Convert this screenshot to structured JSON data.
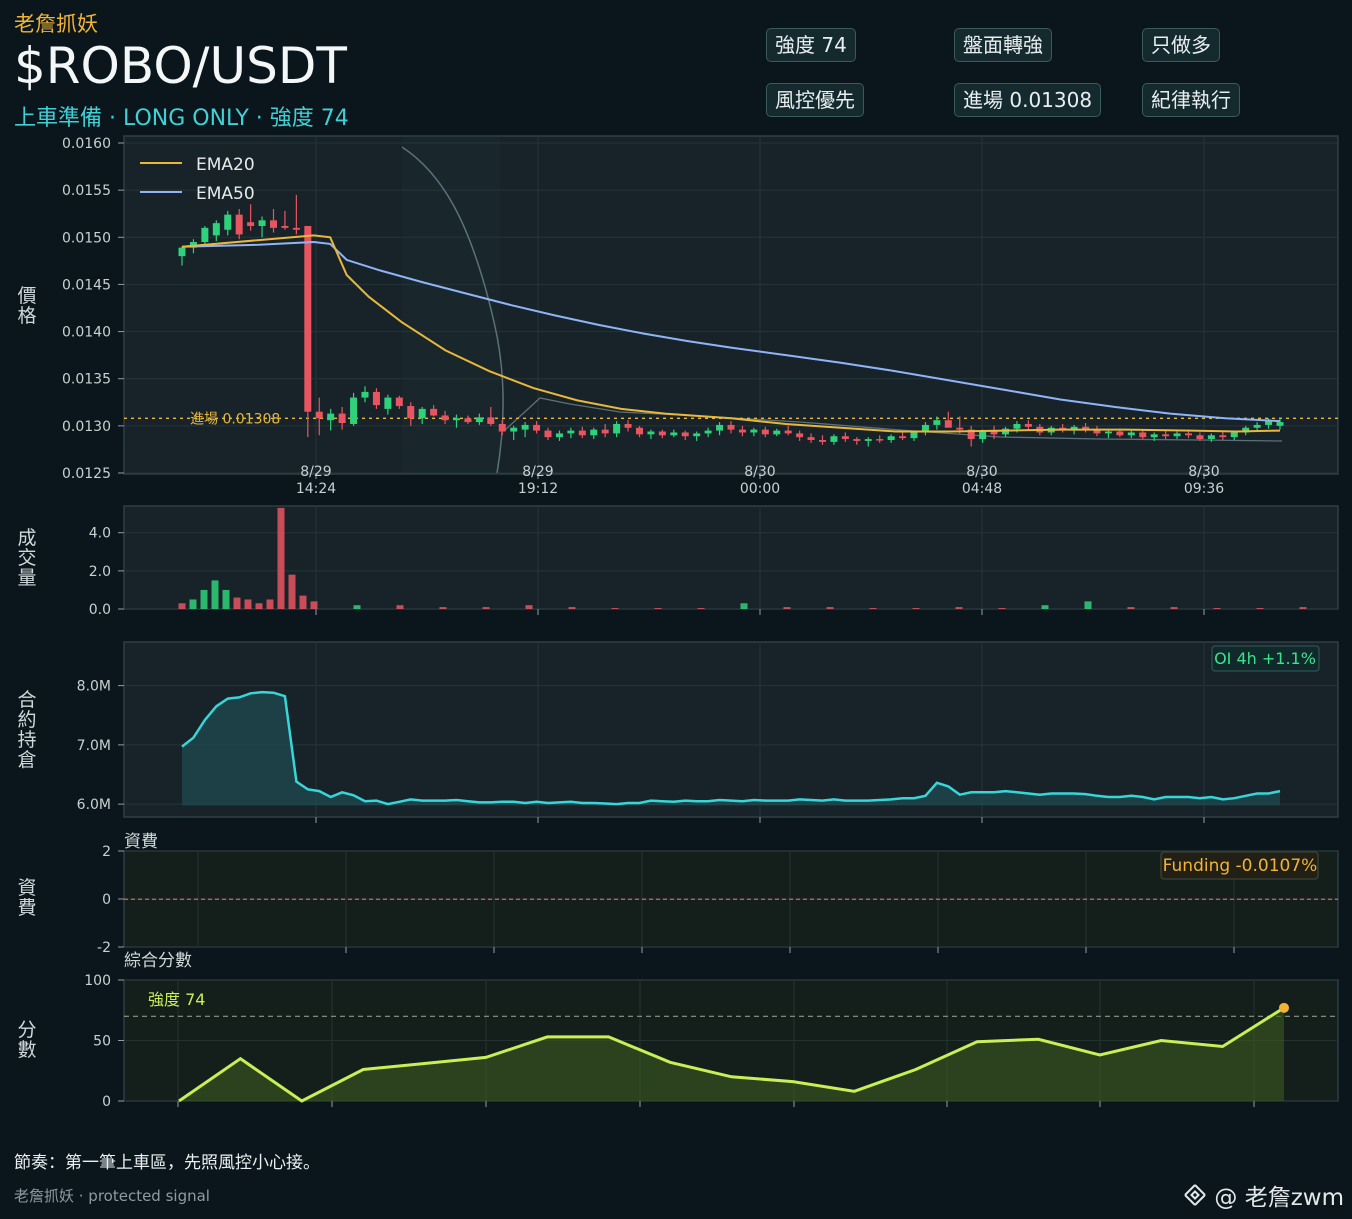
{
  "header": {
    "brand": "老詹抓妖",
    "symbol": "$ROBO/USDT",
    "subtitle": "上車準備 · LONG ONLY · 強度 74",
    "badges": [
      "強度 74",
      "盤面轉強",
      "只做多",
      "風控優先",
      "進場 0.01308",
      "紀律執行"
    ]
  },
  "panel_labels": {
    "price": "價格",
    "volume": "成交量",
    "oi": "合約持倉",
    "funding": "資費",
    "score": "分數"
  },
  "footer": {
    "note": "節奏：第一筆上車區，先照風控小心接。",
    "signature": "老詹抓妖 · protected signal",
    "watermark": "@ 老詹zwm"
  },
  "colors": {
    "up": "#2fd17a",
    "down": "#e85560",
    "ema20": "#e9b73a",
    "ema50": "#8fb4f7",
    "oi": "#37d6d8",
    "score": "#c8ef55",
    "accent": "#f1b434"
  },
  "icons": {
    "watermark": "binance-logo-icon"
  },
  "chart_data": [
    {
      "type": "candlestick",
      "ylim": [
        0.0125,
        0.016
      ],
      "yticks": [
        "0.0125",
        "0.0130",
        "0.0135",
        "0.0140",
        "0.0145",
        "0.0150",
        "0.0155",
        "0.0160"
      ],
      "xticks": [
        {
          "date": "8/29",
          "time": "14:24"
        },
        {
          "date": "8/29",
          "time": "19:12"
        },
        {
          "date": "8/30",
          "time": "00:00"
        },
        {
          "date": "8/30",
          "time": "04:48"
        },
        {
          "date": "8/30",
          "time": "09:36"
        }
      ],
      "legend": [
        "EMA20",
        "EMA50"
      ],
      "legend_position": "top-left",
      "entry_line": {
        "value": 0.01308,
        "label": "進場 0.01308"
      },
      "candles": [
        [
          0.0148,
          0.0149,
          0.0147,
          0.01489
        ],
        [
          0.01489,
          0.01498,
          0.01483,
          0.01495
        ],
        [
          0.01495,
          0.01512,
          0.01492,
          0.0151
        ],
        [
          0.01502,
          0.01518,
          0.01496,
          0.01515
        ],
        [
          0.01508,
          0.01528,
          0.01502,
          0.01524
        ],
        [
          0.01524,
          0.0153,
          0.01498,
          0.01503
        ],
        [
          0.01516,
          0.01535,
          0.01507,
          0.01512
        ],
        [
          0.01512,
          0.01522,
          0.015,
          0.01518
        ],
        [
          0.01518,
          0.0153,
          0.01505,
          0.0151
        ],
        [
          0.01512,
          0.01528,
          0.01508,
          0.0151
        ],
        [
          0.0151,
          0.01545,
          0.01503,
          0.01508
        ],
        [
          0.01512,
          0.01512,
          0.01288,
          0.01315
        ],
        [
          0.01315,
          0.0133,
          0.0129,
          0.01308
        ],
        [
          0.01306,
          0.01318,
          0.01295,
          0.01313
        ],
        [
          0.01313,
          0.0132,
          0.01296,
          0.01303
        ],
        [
          0.01302,
          0.01335,
          0.013,
          0.0133
        ],
        [
          0.0133,
          0.01342,
          0.01325,
          0.01336
        ],
        [
          0.01336,
          0.0134,
          0.01318,
          0.01322
        ],
        [
          0.01318,
          0.01333,
          0.01312,
          0.0133
        ],
        [
          0.0133,
          0.01332,
          0.01318,
          0.01321
        ],
        [
          0.01321,
          0.01325,
          0.013,
          0.01308
        ],
        [
          0.01308,
          0.0132,
          0.01302,
          0.01318
        ],
        [
          0.01318,
          0.01322,
          0.0131,
          0.01311
        ],
        [
          0.01311,
          0.01316,
          0.01302,
          0.01306
        ],
        [
          0.01306,
          0.01312,
          0.01298,
          0.01308
        ],
        [
          0.01308,
          0.01311,
          0.01302,
          0.01304
        ],
        [
          0.01304,
          0.01313,
          0.01301,
          0.01309
        ],
        [
          0.01309,
          0.0132,
          0.013,
          0.01302
        ],
        [
          0.01302,
          0.01306,
          0.0129,
          0.01294
        ],
        [
          0.01294,
          0.013,
          0.01285,
          0.01298
        ],
        [
          0.01296,
          0.01304,
          0.01288,
          0.01301
        ],
        [
          0.01301,
          0.01305,
          0.01292,
          0.01295
        ],
        [
          0.01295,
          0.01298,
          0.01285,
          0.01288
        ],
        [
          0.01288,
          0.01295,
          0.01284,
          0.01292
        ],
        [
          0.01292,
          0.01298,
          0.01287,
          0.01295
        ],
        [
          0.01295,
          0.01299,
          0.01287,
          0.0129
        ],
        [
          0.0129,
          0.01298,
          0.01286,
          0.01296
        ],
        [
          0.01296,
          0.01302,
          0.01288,
          0.01292
        ],
        [
          0.01292,
          0.01305,
          0.01288,
          0.01302
        ],
        [
          0.01302,
          0.01306,
          0.01294,
          0.01298
        ],
        [
          0.01298,
          0.013,
          0.01288,
          0.01291
        ],
        [
          0.01291,
          0.01296,
          0.01286,
          0.01294
        ],
        [
          0.01294,
          0.01296,
          0.01287,
          0.0129
        ],
        [
          0.0129,
          0.01296,
          0.01288,
          0.01293
        ],
        [
          0.01293,
          0.01295,
          0.01285,
          0.01289
        ],
        [
          0.01289,
          0.01294,
          0.01284,
          0.01292
        ],
        [
          0.01292,
          0.01298,
          0.01288,
          0.01295
        ],
        [
          0.01295,
          0.01304,
          0.0129,
          0.01301
        ],
        [
          0.01301,
          0.01305,
          0.01292,
          0.01296
        ],
        [
          0.01296,
          0.013,
          0.01289,
          0.01293
        ],
        [
          0.01293,
          0.01298,
          0.01289,
          0.01296
        ],
        [
          0.01296,
          0.01299,
          0.01288,
          0.01291
        ],
        [
          0.01291,
          0.01297,
          0.01289,
          0.01295
        ],
        [
          0.01295,
          0.013,
          0.0129,
          0.01292
        ],
        [
          0.01292,
          0.01295,
          0.01284,
          0.01288
        ],
        [
          0.01288,
          0.01292,
          0.01282,
          0.01285
        ],
        [
          0.01285,
          0.0129,
          0.0128,
          0.01283
        ],
        [
          0.01283,
          0.01291,
          0.0128,
          0.01289
        ],
        [
          0.01289,
          0.01293,
          0.01283,
          0.01286
        ],
        [
          0.01286,
          0.01288,
          0.0128,
          0.01284
        ],
        [
          0.01284,
          0.01288,
          0.01278,
          0.01286
        ],
        [
          0.01286,
          0.0129,
          0.01282,
          0.01285
        ],
        [
          0.01285,
          0.01291,
          0.01282,
          0.01289
        ],
        [
          0.01289,
          0.01294,
          0.01285,
          0.01287
        ],
        [
          0.01287,
          0.01295,
          0.01284,
          0.01293
        ],
        [
          0.01293,
          0.01304,
          0.0129,
          0.01301
        ],
        [
          0.01301,
          0.0131,
          0.01296,
          0.01306
        ],
        [
          0.01306,
          0.01315,
          0.013,
          0.01298
        ],
        [
          0.01298,
          0.0131,
          0.01292,
          0.01296
        ],
        [
          0.01296,
          0.013,
          0.01278,
          0.01286
        ],
        [
          0.01286,
          0.01296,
          0.01282,
          0.01294
        ],
        [
          0.01294,
          0.013,
          0.01286,
          0.01291
        ],
        [
          0.01291,
          0.01299,
          0.01288,
          0.01297
        ],
        [
          0.01297,
          0.01305,
          0.01293,
          0.01302
        ],
        [
          0.01302,
          0.01306,
          0.01296,
          0.01299
        ],
        [
          0.01299,
          0.01302,
          0.0129,
          0.01293
        ],
        [
          0.01293,
          0.013,
          0.0129,
          0.01298
        ],
        [
          0.01298,
          0.01302,
          0.01293,
          0.01296
        ],
        [
          0.01296,
          0.01301,
          0.01291,
          0.01299
        ],
        [
          0.01299,
          0.01303,
          0.01293,
          0.01296
        ],
        [
          0.01296,
          0.013,
          0.01289,
          0.01292
        ],
        [
          0.01292,
          0.01296,
          0.01287,
          0.01294
        ],
        [
          0.01294,
          0.01297,
          0.01288,
          0.0129
        ],
        [
          0.0129,
          0.01295,
          0.01287,
          0.01293
        ],
        [
          0.01293,
          0.01296,
          0.01286,
          0.01288
        ],
        [
          0.01288,
          0.01293,
          0.01284,
          0.01291
        ],
        [
          0.01291,
          0.01296,
          0.01286,
          0.01289
        ],
        [
          0.01289,
          0.01294,
          0.01286,
          0.01292
        ],
        [
          0.01292,
          0.01296,
          0.01287,
          0.0129
        ],
        [
          0.0129,
          0.01293,
          0.01284,
          0.01286
        ],
        [
          0.01286,
          0.01292,
          0.01283,
          0.0129
        ],
        [
          0.0129,
          0.01294,
          0.01285,
          0.01288
        ],
        [
          0.01288,
          0.01295,
          0.01285,
          0.01293
        ],
        [
          0.01293,
          0.013,
          0.0129,
          0.01298
        ],
        [
          0.01298,
          0.01304,
          0.01295,
          0.01301
        ],
        [
          0.01301,
          0.01308,
          0.01297,
          0.01306
        ],
        [
          0.013,
          0.01309,
          0.01296,
          0.01304
        ]
      ],
      "ema20": [
        [
          0,
          0.0149
        ],
        [
          0.07,
          0.01497
        ],
        [
          0.12,
          0.01502
        ],
        [
          0.135,
          0.015
        ],
        [
          0.15,
          0.0146
        ],
        [
          0.17,
          0.01437
        ],
        [
          0.2,
          0.0141
        ],
        [
          0.24,
          0.0138
        ],
        [
          0.28,
          0.01358
        ],
        [
          0.32,
          0.0134
        ],
        [
          0.36,
          0.01327
        ],
        [
          0.4,
          0.01318
        ],
        [
          0.44,
          0.01313
        ],
        [
          0.5,
          0.01308
        ],
        [
          0.55,
          0.01302
        ],
        [
          0.6,
          0.01298
        ],
        [
          0.65,
          0.01294
        ],
        [
          0.7,
          0.01294
        ],
        [
          0.75,
          0.01295
        ],
        [
          0.8,
          0.01296
        ],
        [
          0.86,
          0.01296
        ],
        [
          0.92,
          0.01295
        ],
        [
          0.96,
          0.01294
        ],
        [
          1,
          0.01295
        ]
      ],
      "ema50": [
        [
          0,
          0.0149
        ],
        [
          0.07,
          0.01492
        ],
        [
          0.12,
          0.01495
        ],
        [
          0.135,
          0.01493
        ],
        [
          0.15,
          0.01476
        ],
        [
          0.18,
          0.01465
        ],
        [
          0.22,
          0.01452
        ],
        [
          0.26,
          0.0144
        ],
        [
          0.3,
          0.01428
        ],
        [
          0.34,
          0.01417
        ],
        [
          0.38,
          0.01407
        ],
        [
          0.42,
          0.01398
        ],
        [
          0.46,
          0.0139
        ],
        [
          0.5,
          0.01383
        ],
        [
          0.55,
          0.01375
        ],
        [
          0.6,
          0.01367
        ],
        [
          0.65,
          0.01358
        ],
        [
          0.7,
          0.01348
        ],
        [
          0.75,
          0.01338
        ],
        [
          0.8,
          0.01328
        ],
        [
          0.85,
          0.0132
        ],
        [
          0.9,
          0.01313
        ],
        [
          0.95,
          0.01308
        ],
        [
          1,
          0.01305
        ]
      ]
    },
    {
      "type": "bar",
      "ylim": [
        0,
        5.4
      ],
      "yticks": [
        "0.0",
        "2.0",
        "4.0"
      ],
      "values": [
        0.3,
        0.5,
        1.0,
        1.5,
        1.0,
        0.6,
        0.5,
        0.3,
        0.5,
        5.3,
        1.8,
        0.7,
        0.4,
        0.2,
        0.2,
        0.1,
        0.1,
        0.2,
        0.1,
        0.05,
        0.05,
        0.05,
        0.3,
        0.1,
        0.1,
        0.05,
        0.05,
        0.1,
        0.05,
        0.2,
        0.4,
        0.1,
        0.1,
        0.05,
        0.05,
        0.1
      ]
    },
    {
      "type": "area",
      "ylim": [
        5.8,
        8.6
      ],
      "yticks": [
        "6.0M",
        "7.0M",
        "8.0M"
      ],
      "badge": "OI 4h +1.1%",
      "values": [
        6.97,
        7.12,
        7.42,
        7.65,
        7.78,
        7.8,
        7.87,
        7.89,
        7.88,
        7.82,
        6.38,
        6.25,
        6.22,
        6.12,
        6.2,
        6.15,
        6.05,
        6.06,
        6.0,
        6.04,
        6.08,
        6.06,
        6.06,
        6.06,
        6.07,
        6.05,
        6.03,
        6.03,
        6.04,
        6.04,
        6.02,
        6.04,
        6.02,
        6.03,
        6.04,
        6.02,
        6.02,
        6.01,
        6.0,
        6.02,
        6.02,
        6.06,
        6.05,
        6.04,
        6.06,
        6.05,
        6.05,
        6.07,
        6.06,
        6.05,
        6.07,
        6.06,
        6.06,
        6.06,
        6.08,
        6.07,
        6.06,
        6.08,
        6.06,
        6.06,
        6.06,
        6.07,
        6.08,
        6.1,
        6.1,
        6.14,
        6.36,
        6.3,
        6.16,
        6.2,
        6.2,
        6.2,
        6.22,
        6.2,
        6.18,
        6.16,
        6.18,
        6.18,
        6.18,
        6.17,
        6.14,
        6.12,
        6.12,
        6.14,
        6.12,
        6.08,
        6.12,
        6.12,
        6.12,
        6.1,
        6.12,
        6.08,
        6.1,
        6.14,
        6.18,
        6.18,
        6.22
      ]
    },
    {
      "type": "line",
      "title": "資費",
      "ylim": [
        -2,
        2
      ],
      "yticks": [
        "-2",
        "0",
        "2"
      ],
      "badge": "Funding -0.0107%",
      "values": [
        -0.0107,
        -0.0107
      ]
    },
    {
      "type": "area",
      "title": "綜合分數",
      "ylim": [
        0,
        100
      ],
      "yticks": [
        "0",
        "50",
        "100"
      ],
      "threshold": {
        "value": 70,
        "label": "強度 74"
      },
      "values": [
        0,
        35,
        0,
        26,
        31,
        36,
        53,
        53,
        32,
        20,
        16,
        8,
        26,
        49,
        51,
        38,
        50,
        45,
        77
      ]
    }
  ]
}
